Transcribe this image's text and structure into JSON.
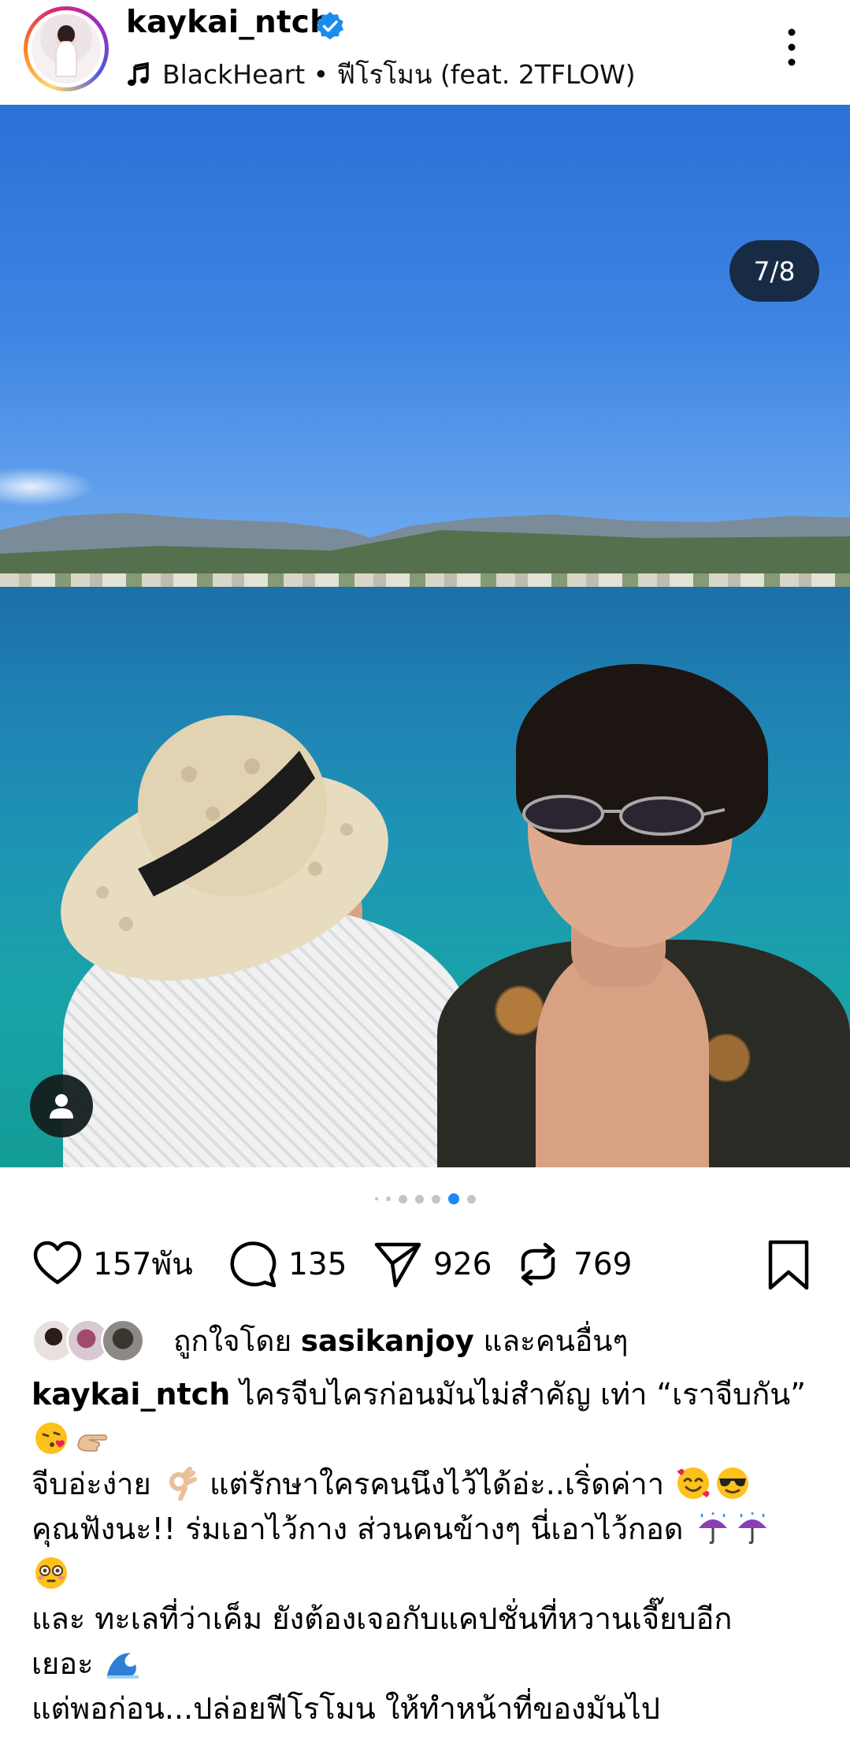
{
  "header": {
    "username": "kaykai_ntch",
    "music": "BlackHeart • ฟีโรโมน (feat. 2TFLOW)",
    "icons": {
      "verified": "verified-badge-icon",
      "music": "music-note-icon",
      "more": "more-vertical-icon"
    }
  },
  "post": {
    "counter": "7/8",
    "carousel": {
      "total_dots": 6,
      "active_index": 4
    }
  },
  "actions": {
    "likes": "157พัน",
    "comments": "135",
    "shares": "926",
    "reposts": "769"
  },
  "liked_by": {
    "prefix": "ถูกใจโดย",
    "user": "sasikanjoy",
    "suffix": "และคนอื่นๆ"
  },
  "caption": {
    "user": "kaykai_ntch",
    "line1": "ไครจีบไครก่อนมันไม่สำคัญ เท่า “เราจีบกัน”",
    "line3a": "จีบอ่ะง่าย",
    "line3b": "แต่รักษาใครคนนึงไว้ได้อ่ะ..เริ่ดค่าา",
    "line4": "คุณฟังนะ!! ร่มเอาไว้กาง ส่วนคนข้างๆ นี่เอาไว้กอด",
    "line6": "และ ทะเลที่ว่าเค็ม ยังต้องเจอกับแคปชั่นที่หวานเจี๊ยบอีก",
    "line7": "เยอะ",
    "line8": "แต่พอก่อน...ปล่อยฟีโรโมน ให้ทำหน้าที่ของมันไป"
  },
  "colors": {
    "accent": "#1a8cf0",
    "counter_bg": "#152436"
  }
}
